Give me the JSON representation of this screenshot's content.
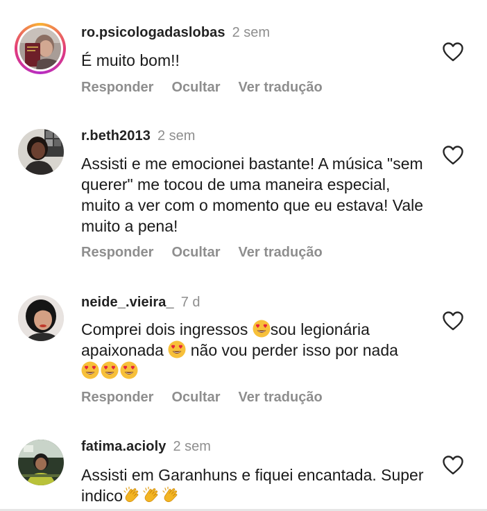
{
  "comments": [
    {
      "username": "ro.psicologadaslobas",
      "time": "2 sem",
      "text": "É muito bom!!",
      "reply": "Responder",
      "hide": "Ocultar",
      "translate": "Ver tradução",
      "avatar_icon": "profile-photo-with-story-ring"
    },
    {
      "username": "r.beth2013",
      "time": "2 sem",
      "text": "Assisti e me emocionei bastante! A música \"sem querer\" me tocou de uma maneira especial, muito a ver com o momento que eu estava! Vale muito a pena!",
      "reply": "Responder",
      "hide": "Ocultar",
      "translate": "Ver tradução"
    },
    {
      "username": "neide_.vieira_",
      "time": "7 d",
      "text_part1": "Comprei dois ingressos ",
      "text_part2": "sou legionária apaixonada ",
      "text_part3": " não vou perder isso por nada ",
      "reply": "Responder",
      "hide": "Ocultar",
      "translate": "Ver tradução",
      "emoji": "heart-eyes-emoji"
    },
    {
      "username": "fatima.acioly",
      "time": "2 sem",
      "text": "Assisti em Garanhuns e fiquei encantada. Super indico",
      "emoji": "clapping-hands-emoji"
    }
  ],
  "colors": {
    "secondary_text": "#8e8e8e",
    "primary_text": "#1a1a1a",
    "background": "#ffffff"
  }
}
